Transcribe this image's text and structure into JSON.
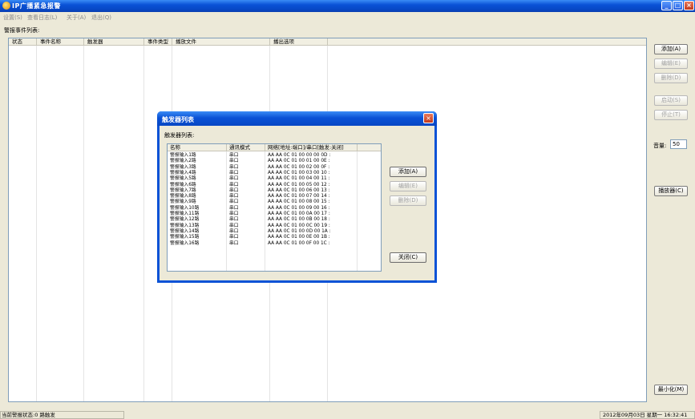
{
  "window": {
    "title": "IP广播紧急报警"
  },
  "menu": [
    "设置(S)",
    "查看日志(L)",
    "关于(A)",
    "退出(Q)"
  ],
  "main": {
    "section_label": "警报事件列表:",
    "columns": [
      "状态",
      "事件名称",
      "触发器",
      "事件类型",
      "播放文件",
      "播出选项"
    ]
  },
  "side_buttons": {
    "add": "添加(A)",
    "edit": "编辑(E)",
    "delete": "删除(D)",
    "start": "启动(S)",
    "stop": "停止(T)",
    "player": "播放器(C)",
    "minimize": "最小化(M)"
  },
  "volume": {
    "label": "音量:",
    "value": "50"
  },
  "status": {
    "left": "当前警报状态:0 路触发",
    "right": "2012年09月03日 星期一 16:32:41"
  },
  "dialog": {
    "title": "触发器列表",
    "list_label": "触发器列表:",
    "columns": [
      "名称",
      "通讯模式",
      "网络[地址:端口]/串口[触发:关闭]"
    ],
    "rows": [
      {
        "name": "警报输入1路",
        "mode": "串口",
        "code": "AA AA 0C 01 00 00 00 0D :"
      },
      {
        "name": "警报输入2路",
        "mode": "串口",
        "code": "AA AA 0C 01 00 01 00 0E :"
      },
      {
        "name": "警报输入3路",
        "mode": "串口",
        "code": "AA AA 0C 01 00 02 00 0F :"
      },
      {
        "name": "警报输入4路",
        "mode": "串口",
        "code": "AA AA 0C 01 00 03 00 10 :"
      },
      {
        "name": "警报输入5路",
        "mode": "串口",
        "code": "AA AA 0C 01 00 04 00 11 :"
      },
      {
        "name": "警报输入6路",
        "mode": "串口",
        "code": "AA AA 0C 01 00 05 00 12 :"
      },
      {
        "name": "警报输入7路",
        "mode": "串口",
        "code": "AA AA 0C 01 00 06 00 13 :"
      },
      {
        "name": "警报输入8路",
        "mode": "串口",
        "code": "AA AA 0C 01 00 07 00 14 :"
      },
      {
        "name": "警报输入9路",
        "mode": "串口",
        "code": "AA AA 0C 01 00 08 00 15 :"
      },
      {
        "name": "警报输入10路",
        "mode": "串口",
        "code": "AA AA 0C 01 00 09 00 16 :"
      },
      {
        "name": "警报输入11路",
        "mode": "串口",
        "code": "AA AA 0C 01 00 0A 00 17 :"
      },
      {
        "name": "警报输入12路",
        "mode": "串口",
        "code": "AA AA 0C 01 00 0B 00 18 :"
      },
      {
        "name": "警报输入13路",
        "mode": "串口",
        "code": "AA AA 0C 01 00 0C 00 19 :"
      },
      {
        "name": "警报输入14路",
        "mode": "串口",
        "code": "AA AA 0C 01 00 0D 00 1A :"
      },
      {
        "name": "警报输入15路",
        "mode": "串口",
        "code": "AA AA 0C 01 00 0E 00 1B :"
      },
      {
        "name": "警报输入16路",
        "mode": "串口",
        "code": "AA AA 0C 01 00 0F 00 1C :"
      }
    ],
    "buttons": {
      "add": "添加(A)",
      "edit": "编辑(E)",
      "delete": "删除(D)",
      "close": "关闭(C)"
    }
  }
}
